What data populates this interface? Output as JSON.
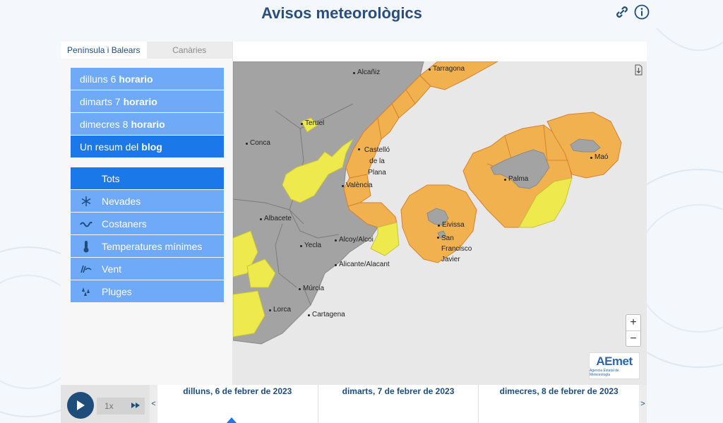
{
  "page": {
    "title": "Avisos meteorològics"
  },
  "tabs": [
    "Península i Balears",
    "Canàries"
  ],
  "days_menu": [
    {
      "label": "dilluns 6",
      "bold": "horario"
    },
    {
      "label": "dimarts 7",
      "bold": "horario"
    },
    {
      "label": "dimecres 8",
      "bold": "horario"
    },
    {
      "label": "Un resum del",
      "bold": "blog"
    }
  ],
  "categories": [
    {
      "label": "Tots",
      "icon": "none"
    },
    {
      "label": "Nevades",
      "icon": "snowflake-icon"
    },
    {
      "label": "Costaners",
      "icon": "wave-icon"
    },
    {
      "label": "Temperatures mínimes",
      "icon": "thermometer-icon"
    },
    {
      "label": "Vent",
      "icon": "wind-icon"
    },
    {
      "label": "Pluges",
      "icon": "rain-icon"
    }
  ],
  "map": {
    "cities": [
      "Alcañiz",
      "Tarragona",
      "Teruel",
      "Conca",
      "Castelló de la Plana",
      "València",
      "Albacete",
      "Alcoy/Alcoi",
      "Yecla",
      "Alicante/Alacant",
      "Múrcia",
      "Lorca",
      "Cartagena",
      "Palma",
      "Maó",
      "Eivissa",
      "San Francisco Javier"
    ],
    "zoom_in": "+",
    "zoom_out": "−",
    "logo_text": "AEmet",
    "logo_sub": "Agencia Estatal de Meteorología",
    "colors": {
      "orange": "#f2b14f",
      "yellow": "#eee94d",
      "land": "#a3a3a3",
      "sea": "#e8e8e8"
    }
  },
  "player": {
    "speed": "1x"
  },
  "timeline": {
    "prev": "<",
    "next": ">",
    "days": [
      "dilluns, 6 de febrer de 2023",
      "dimarts, 7 de febrer de 2023",
      "dimecres, 8 de febrer de 2023"
    ]
  }
}
